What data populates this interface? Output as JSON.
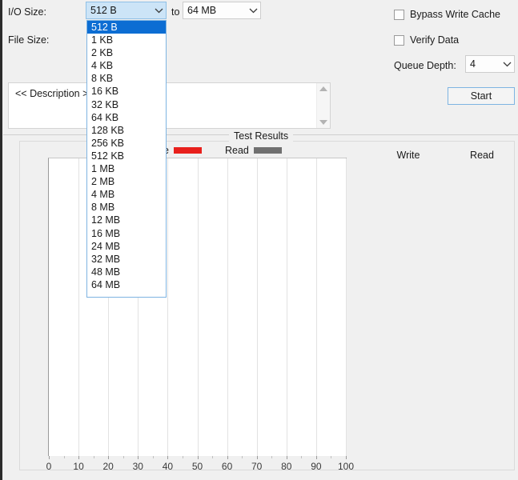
{
  "form": {
    "io_size_label": "I/O Size:",
    "file_size_label": "File Size:",
    "to_label": "to",
    "io_size_from_value": "512 B",
    "io_size_to_value": "64 MB",
    "description_placeholder": "<< Description >>"
  },
  "dropdown": {
    "open": true,
    "selected": "512 B",
    "items": [
      "512 B",
      "1 KB",
      "2 KB",
      "4 KB",
      "8 KB",
      "16 KB",
      "32 KB",
      "64 KB",
      "128 KB",
      "256 KB",
      "512 KB",
      "1 MB",
      "2 MB",
      "4 MB",
      "8 MB",
      "12 MB",
      "16 MB",
      "24 MB",
      "32 MB",
      "48 MB",
      "64 MB"
    ]
  },
  "options": {
    "bypass_write_cache_label": "Bypass Write Cache",
    "bypass_write_cache_checked": false,
    "verify_data_label": "Verify Data",
    "verify_data_checked": false,
    "queue_depth_label": "Queue Depth:",
    "queue_depth_value": "4"
  },
  "actions": {
    "start_label": "Start"
  },
  "results": {
    "group_title": "Test Results",
    "write_column_header": "Write",
    "read_column_header": "Read"
  },
  "colors": {
    "write": "#e8201c",
    "read": "#707070",
    "accent": "#0c6dd3",
    "focus_border": "#7eb4e2",
    "window_bg": "#f0f0f0"
  },
  "chart_data": {
    "type": "line",
    "title": "Test Results",
    "xlabel": "",
    "ylabel": "",
    "xlim": [
      0,
      100
    ],
    "xticks": [
      0,
      10,
      20,
      30,
      40,
      50,
      60,
      70,
      80,
      90,
      100
    ],
    "xtick_labels": [
      "0",
      "10",
      "20",
      "30",
      "40",
      "50",
      "60",
      "70",
      "80",
      "90",
      "100"
    ],
    "grid": true,
    "legend_position": "top",
    "series": [
      {
        "name": "Write",
        "color": "#e8201c",
        "values": []
      },
      {
        "name": "Read",
        "color": "#707070",
        "values": []
      }
    ]
  }
}
